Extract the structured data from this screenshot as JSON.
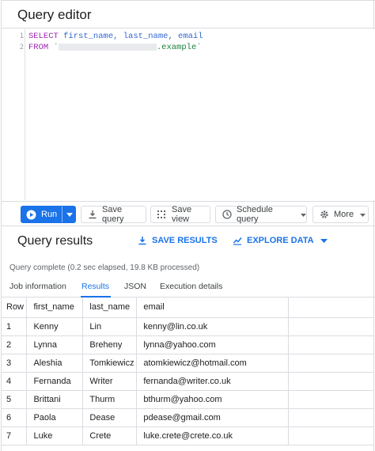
{
  "editor": {
    "title": "Query editor",
    "line_numbers": [
      "1",
      "2"
    ],
    "line1": {
      "keyword": "SELECT",
      "columns": "first_name, last_name, email"
    },
    "line2": {
      "keyword": "FROM",
      "tick_open": "`",
      "table_suffix": ".example`"
    }
  },
  "toolbar": {
    "run_label": "Run",
    "save_query_label": "Save query",
    "save_view_label": "Save view",
    "schedule_query_label": "Schedule query",
    "more_label": "More"
  },
  "results": {
    "title": "Query results",
    "save_results_label": "SAVE RESULTS",
    "explore_data_label": "EXPLORE DATA",
    "status": "Query complete (0.2 sec elapsed, 19.8 KB processed)",
    "tabs": [
      "Job information",
      "Results",
      "JSON",
      "Execution details"
    ],
    "active_tab": "Results",
    "columns": [
      "Row",
      "first_name",
      "last_name",
      "email"
    ],
    "rows": [
      [
        "1",
        "Kenny",
        "Lin",
        "kenny@lin.co.uk"
      ],
      [
        "2",
        "Lynna",
        "Breheny",
        "lynna@yahoo.com"
      ],
      [
        "3",
        "Aleshia",
        "Tomkiewicz",
        "atomkiewicz@hotmail.com"
      ],
      [
        "4",
        "Fernanda",
        "Writer",
        "fernanda@writer.co.uk"
      ],
      [
        "5",
        "Brittani",
        "Thurm",
        "bthurm@yahoo.com"
      ],
      [
        "6",
        "Paola",
        "Dease",
        "pdease@gmail.com"
      ],
      [
        "7",
        "Luke",
        "Crete",
        "luke.crete@crete.co.uk"
      ]
    ]
  },
  "colors": {
    "accent": "#1a73e8",
    "keyword": "#9c27b0",
    "identifier": "#3367d6",
    "string": "#188038"
  }
}
